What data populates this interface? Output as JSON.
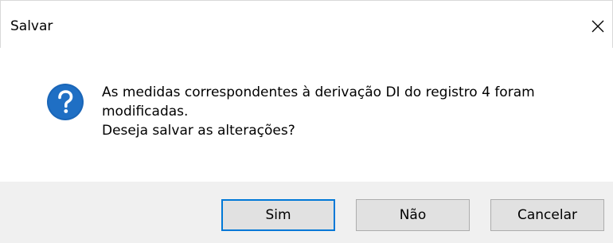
{
  "window": {
    "title": "Salvar"
  },
  "message": {
    "line1": "As medidas correspondentes à derivação DI do registro 4 foram",
    "line2": "modificadas.",
    "line3": "Deseja salvar as alterações?"
  },
  "icons": {
    "question": "question-icon",
    "close": "close-icon"
  },
  "buttons": {
    "yes_label": "Sim",
    "no_label": "Não",
    "cancel_label": "Cancelar"
  },
  "colors": {
    "accent": "#0078d7",
    "icon_blue": "#1a66b8",
    "footer_bg": "#f0f0f0",
    "button_bg": "#e1e1e1"
  }
}
